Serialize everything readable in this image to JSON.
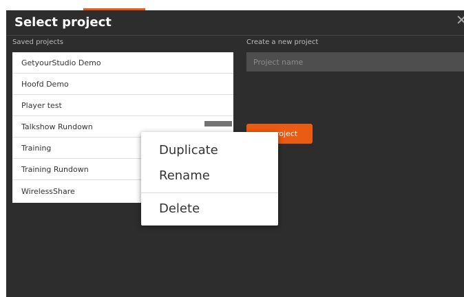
{
  "dialog": {
    "title": "Select project",
    "close_icon": "close-icon"
  },
  "saved_projects": {
    "label": "Saved projects",
    "items": [
      {
        "label": "GetyourStudio Demo"
      },
      {
        "label": "Hoofd Demo"
      },
      {
        "label": "Player test"
      },
      {
        "label": "Talkshow Rundown"
      },
      {
        "label": "Training"
      },
      {
        "label": "Training Rundown"
      },
      {
        "label": "WirelessShare"
      }
    ]
  },
  "new_project": {
    "label": "Create a new project",
    "name_placeholder": "Project name",
    "create_label": "project"
  },
  "context_menu": {
    "items": [
      {
        "label": "Duplicate"
      },
      {
        "label": "Rename"
      },
      {
        "label": "Delete"
      }
    ]
  },
  "colors": {
    "accent": "#ea5b14",
    "background": "#2d2d2d",
    "input": "#4e4e4e"
  }
}
